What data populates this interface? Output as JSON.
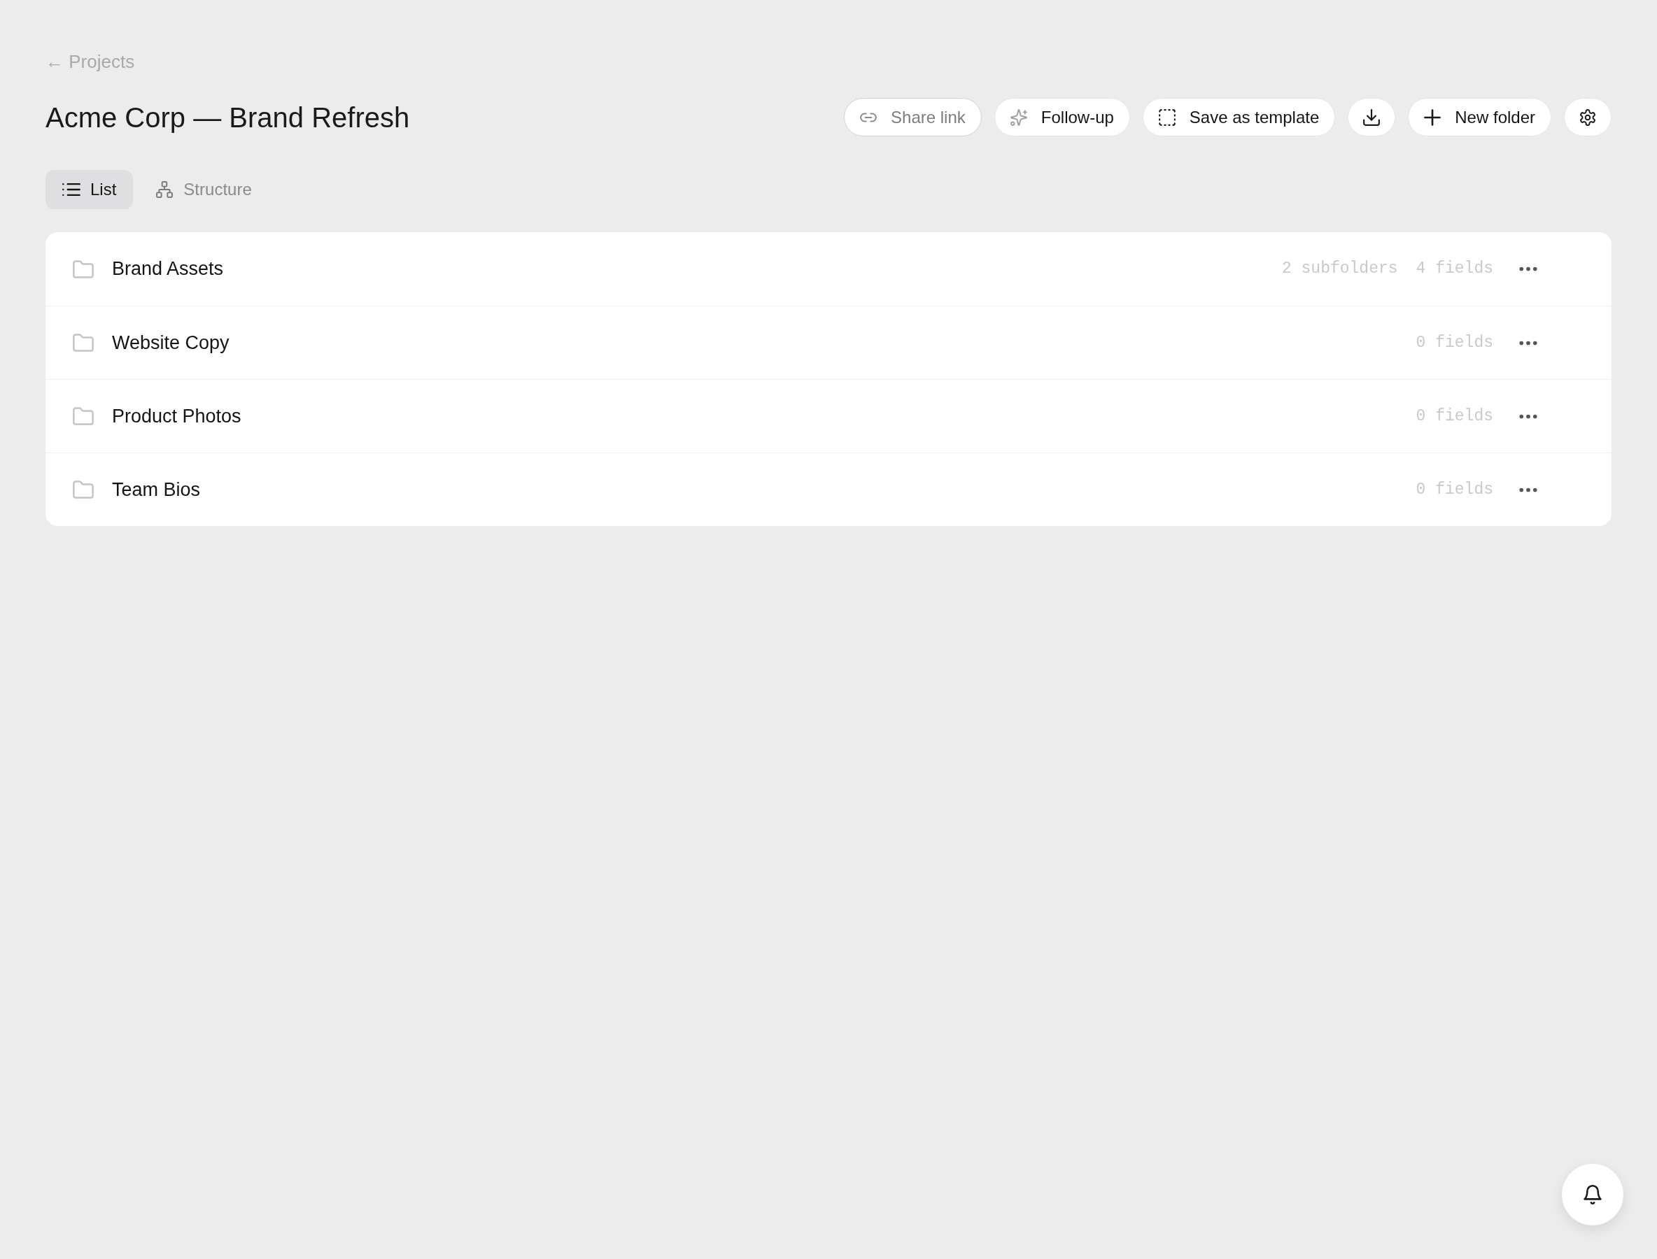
{
  "breadcrumb": {
    "label": "← Projects"
  },
  "title": "Acme Corp — Brand Refresh",
  "toolbar": {
    "buttons": [
      {
        "kind": "labeled",
        "label": "Share link",
        "disabled": true
      },
      {
        "kind": "labeled",
        "label": "Follow-up",
        "disabled": false
      },
      {
        "kind": "labeled",
        "label": "Save as template",
        "disabled": false
      },
      {
        "kind": "icon",
        "disabled": false
      },
      {
        "kind": "labeled",
        "label": "New folder",
        "disabled": false
      },
      {
        "kind": "icon",
        "disabled": false
      }
    ]
  },
  "view_tabs": [
    {
      "label": "List",
      "selected": true
    },
    {
      "label": "Structure",
      "selected": false
    }
  ],
  "folders": [
    {
      "name": "Brand Assets",
      "subfolders": "2 subfolders",
      "fields": "4 fields"
    },
    {
      "name": "Website Copy",
      "fields": "0 fields"
    },
    {
      "name": "Product Photos",
      "fields": "0 fields"
    },
    {
      "name": "Team Bios",
      "fields": "0 fields"
    }
  ]
}
